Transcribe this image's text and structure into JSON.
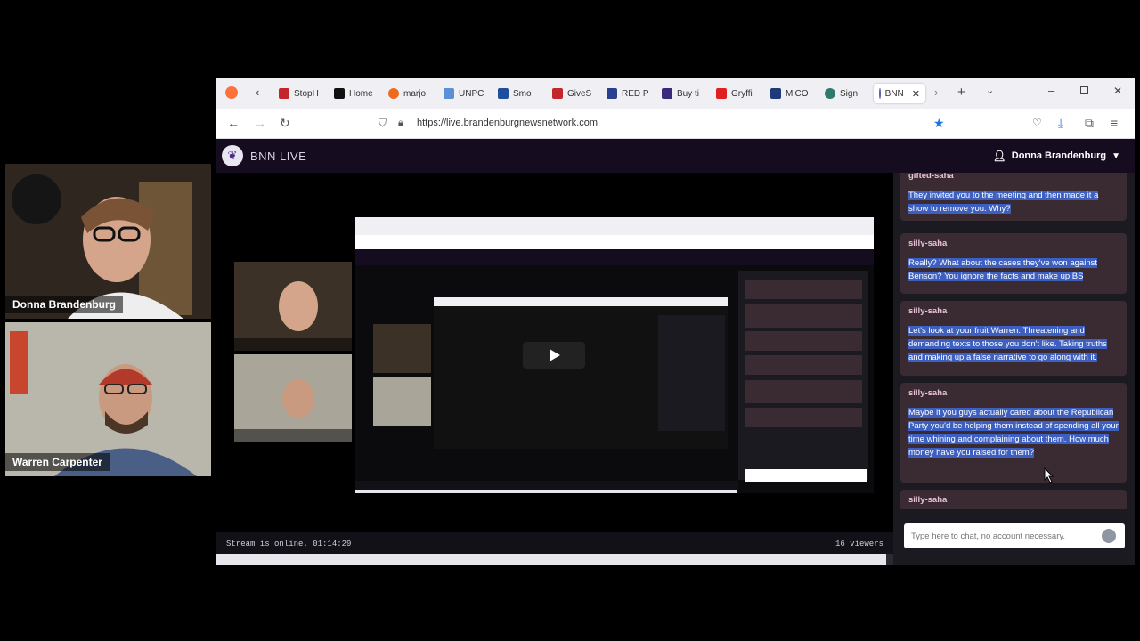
{
  "webcams": [
    {
      "name": "Donna Brandenburg"
    },
    {
      "name": "Warren Carpenter"
    }
  ],
  "browser": {
    "tabs": [
      {
        "label": "StopH",
        "color": "#c4262e"
      },
      {
        "label": "Home",
        "color": "#111111"
      },
      {
        "label": "marjo",
        "color": "#f06a1c"
      },
      {
        "label": "UNPC",
        "color": "#5b8fd6"
      },
      {
        "label": "Smo",
        "color": "#1d4f9c"
      },
      {
        "label": "GiveS",
        "color": "#c4262e"
      },
      {
        "label": "RED P",
        "color": "#2b3f8f"
      },
      {
        "label": "Buy ti",
        "color": "#3b2a7c"
      },
      {
        "label": "Gryffi",
        "color": "#e02020"
      },
      {
        "label": "MiCO",
        "color": "#1e3a78"
      },
      {
        "label": "Sign",
        "color": "#2f7a6b"
      },
      {
        "label": "BNN",
        "color": "#5a5fa8"
      }
    ],
    "url": "https://live.brandenburgnewsnetwork.com"
  },
  "site": {
    "title": "BNN LIVE",
    "user": "Donna Brandenburg"
  },
  "stream": {
    "status": "Stream is online. 01:14:29",
    "viewers": "16 viewers",
    "progress_fraction": 0.99
  },
  "chat": {
    "messages": [
      {
        "user": "gifted-saha",
        "text": "They invited you to the meeting and then made it a show to remove you. Why?"
      },
      {
        "user": "silly-saha",
        "text": "Really? What about the cases they've won against Benson? You ignore the facts and make up BS"
      },
      {
        "user": "silly-saha",
        "text": "Let's look at your fruit Warren. Threatening and demanding texts to those you don't like. Taking truths and making up a false narrative to go along with it."
      },
      {
        "user": "silly-saha",
        "text": "Maybe if you guys actually cared about the Republican Party you'd be helping them instead of spending all your time whining and complaining about them. How much money have you raised for them?"
      },
      {
        "user": "silly-saha",
        "text": ""
      }
    ],
    "input_placeholder": "Type here to chat, no account necessary."
  }
}
